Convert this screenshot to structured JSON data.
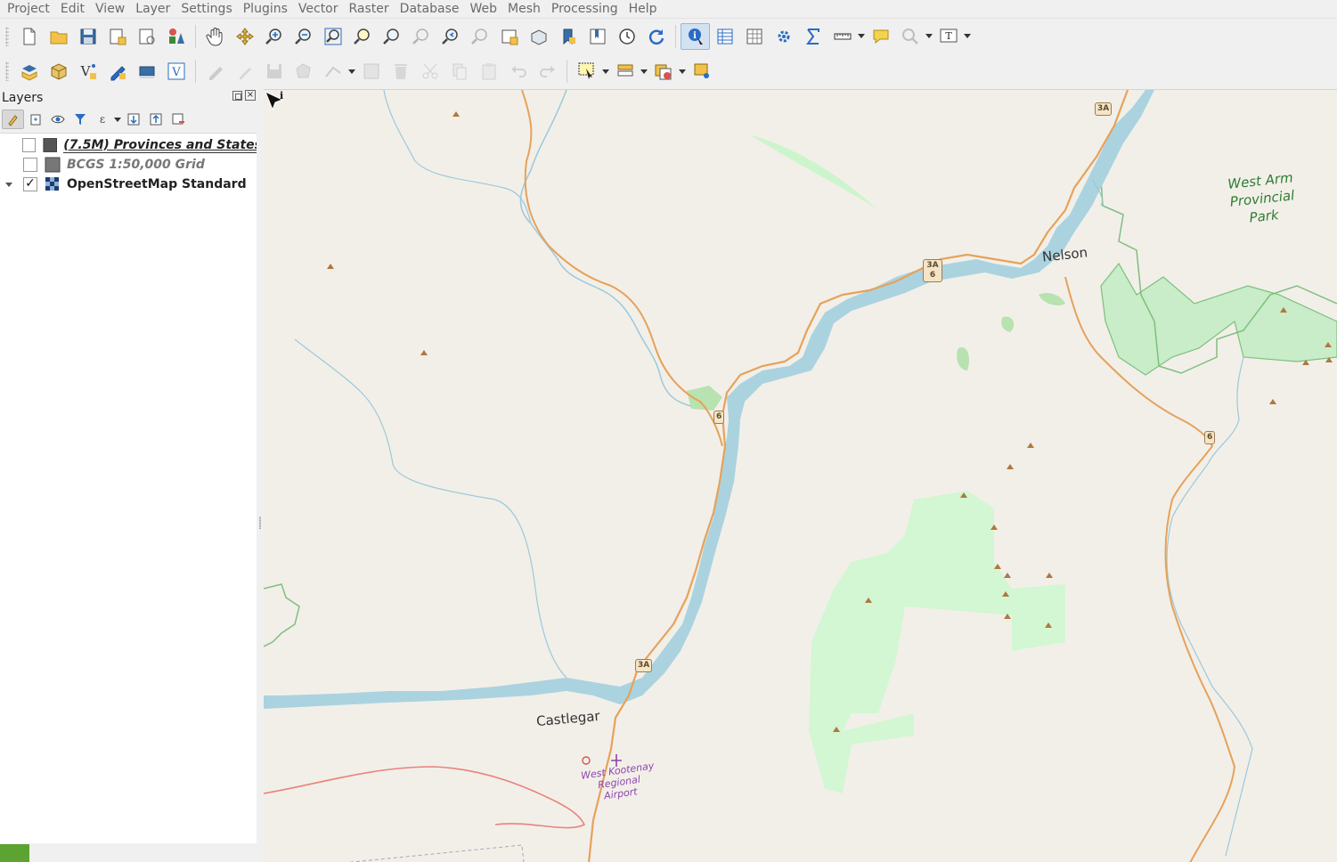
{
  "menu": [
    "Project",
    "Edit",
    "View",
    "Layer",
    "Settings",
    "Plugins",
    "Vector",
    "Raster",
    "Database",
    "Web",
    "Mesh",
    "Processing",
    "Help"
  ],
  "layers_panel": {
    "title": "Layers",
    "layers": [
      {
        "name": "(7.5M) Provinces and States -",
        "checked": false,
        "style": "underline-italic",
        "swatch": "#555555"
      },
      {
        "name": "BCGS 1:50,000 Grid",
        "checked": false,
        "style": "italic",
        "swatch": "#777777"
      },
      {
        "name": "OpenStreetMap Standard",
        "checked": true,
        "style": "normal",
        "swatch": "raster",
        "expanded": true
      }
    ]
  },
  "map": {
    "labels": {
      "nelson": "Nelson",
      "castlegar": "Castlegar",
      "park": "West Arm Provincial Park",
      "airport": "West Kootenay Regional Airport"
    },
    "shields": [
      "3A",
      "3A 6",
      "6",
      "6",
      "3A"
    ],
    "colors": {
      "land": "#f2efe9",
      "water": "#aad3df",
      "park": "#cdf7cd",
      "park_border": "#8cc28c",
      "road": "#f5c58a",
      "trail": "#e9837a"
    }
  }
}
